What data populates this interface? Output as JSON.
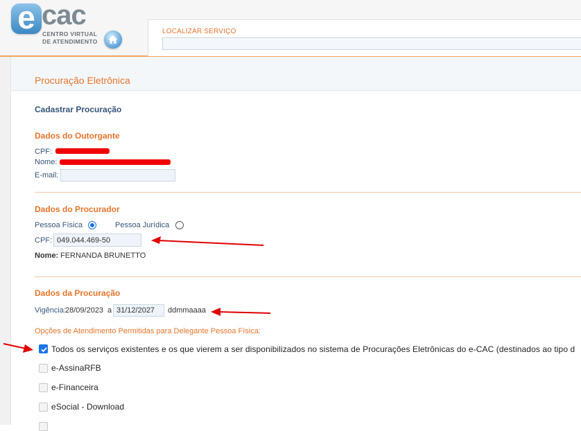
{
  "header": {
    "logo_e": "e",
    "logo_cac": "cac",
    "logo_sub_line1": "CENTRO VIRTUAL",
    "logo_sub_line2": "DE ATENDIMENTO",
    "search_label": "LOCALIZAR SERVIÇO",
    "search_value": ""
  },
  "page": {
    "title": "Procuração Eletrônica",
    "subtitle": "Cadastrar Procuração"
  },
  "outorgante": {
    "title": "Dados do Outorgante",
    "cpf_label": "CPF:",
    "nome_label": "Nome:",
    "email_label": "E-mail:",
    "email_value": ""
  },
  "procurador": {
    "title": "Dados do Procurador",
    "pf_label": "Pessoa Física",
    "pj_label": "Pessoa Jurídica",
    "cpf_label": "CPF:",
    "cpf_value": "049.044.469-50",
    "nome_label": "Nome:",
    "nome_value": "FERNANDA BRUNETTO"
  },
  "procuracao": {
    "title": "Dados da Procuração",
    "vigencia_label": "Vigência:",
    "start_date": "28/09/2023",
    "a_label": "a",
    "end_date": "31/12/2027",
    "date_hint": "ddmmaaaa",
    "options_title": "Opções de Atendimento Permitidas para Delegante Pessoa Física:",
    "options": [
      {
        "label": "Todos os serviços existentes e os que vierem a ser disponibilizados no sistema de Procurações Eletrônicas do e-CAC (destinados ao tipo d",
        "checked": true
      },
      {
        "label": "e-AssinaRFB",
        "checked": false
      },
      {
        "label": "e-Financeira",
        "checked": false
      },
      {
        "label": "eSocial - Download",
        "checked": false
      }
    ]
  },
  "colors": {
    "accent_orange": "#e5742b",
    "label_blue": "#35557a",
    "checkbox_blue": "#1a73e8",
    "annotation_red": "#e00000"
  }
}
